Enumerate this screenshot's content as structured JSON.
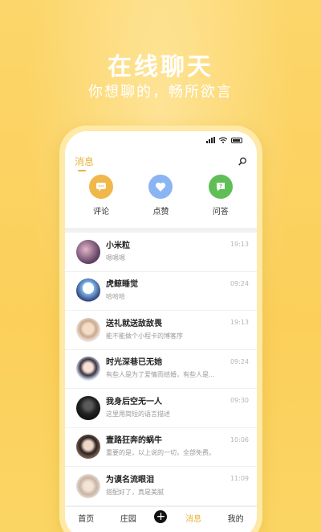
{
  "promo": {
    "title": "在线聊天",
    "subtitle": "你想聊的，畅所欲言"
  },
  "header": {
    "tab_label": "消息",
    "search_icon": "search-icon"
  },
  "quick_actions": [
    {
      "label": "评论",
      "icon": "comment-icon",
      "color": "#f0b84a"
    },
    {
      "label": "点赞",
      "icon": "heart-icon",
      "color": "#8bb4f3"
    },
    {
      "label": "问答",
      "icon": "question-icon",
      "color": "#5fbe56"
    }
  ],
  "messages": [
    {
      "name": "小米粒",
      "text": "嗯嗯嗯",
      "time": "19:13"
    },
    {
      "name": "虎鲸睡觉",
      "text": "哈哈哈",
      "time": "09:24"
    },
    {
      "name": "送礼就送敌敌畏",
      "text": "能不能做个小程卡的博客序",
      "time": "19:13"
    },
    {
      "name": "时光深巷已无她",
      "text": "有些人是为了爱情而结婚，有些人是...",
      "time": "09:24"
    },
    {
      "name": "我身后空无一人",
      "text": "这里用简短的语言描述",
      "time": "09:30"
    },
    {
      "name": "壹路狂奔的蜗牛",
      "text": "重要的是，以上说的一切，全部免费。",
      "time": "10:06"
    },
    {
      "name": "为谟名流眼泪",
      "text": "搭配好了，真是美腻",
      "time": "11:09"
    }
  ],
  "navbar": {
    "home": "首页",
    "garden": "庄园",
    "add": "+",
    "messages": "消息",
    "mine": "我的"
  }
}
